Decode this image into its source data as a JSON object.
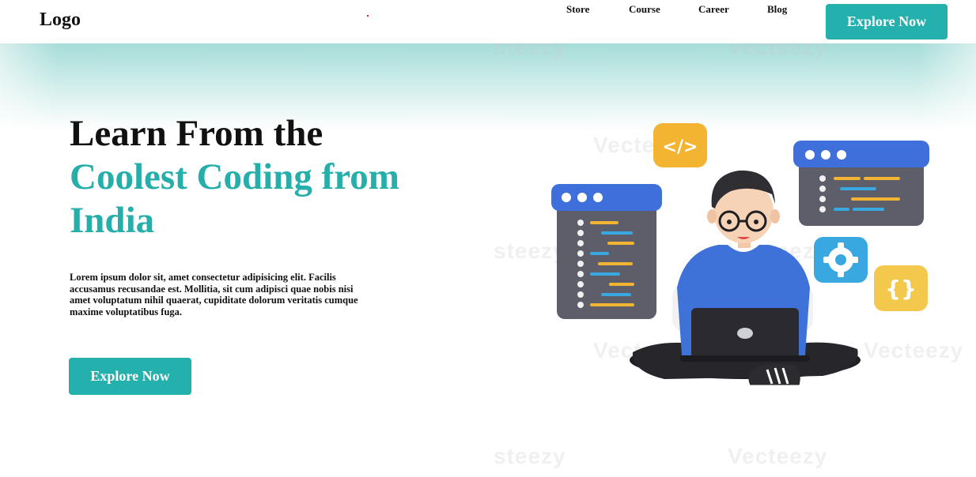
{
  "header": {
    "logo": "Logo",
    "nav": [
      "Store",
      "Course",
      "Career",
      "Blog"
    ],
    "cta_label": "Explore Now"
  },
  "hero": {
    "title_line1": "Learn From the",
    "title_line2": "Coolest Coding from India",
    "description": "Lorem ipsum dolor sit, amet consectetur adipisicing elit. Facilis accusamus recusandae est. Mollitia, sit cum adipisci quae nobis nisi amet voluptatum nihil quaerat, cupiditate dolorum veritatis cumque maxime voluptatibus fuga.",
    "cta_label": "Explore Now"
  },
  "illustration": {
    "code_badge": "</>",
    "brace_badge": "{}"
  },
  "watermark": {
    "text": "Vecteezy",
    "fragment": "steezy"
  },
  "colors": {
    "accent": "#24b0ad",
    "title_dark": "#111111",
    "title_accent": "#26aeab",
    "band_top": "#a6dcd8"
  }
}
